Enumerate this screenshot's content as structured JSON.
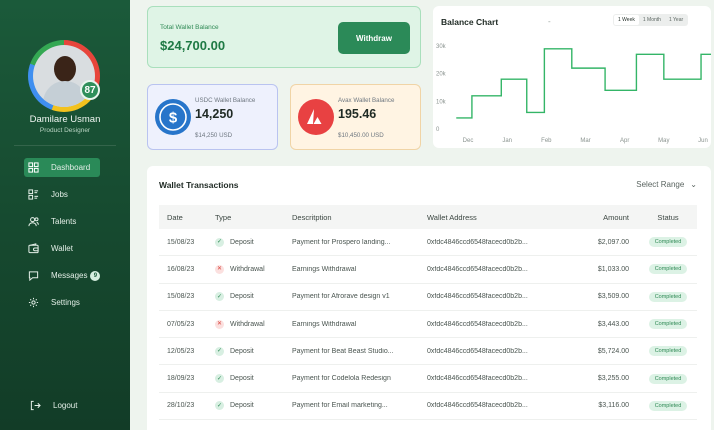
{
  "user": {
    "name": "Damilare Usman",
    "role": "Product Designer",
    "level": "87"
  },
  "nav": [
    {
      "label": "Dashboard",
      "icon": "dashboard-icon",
      "active": true
    },
    {
      "label": "Jobs",
      "icon": "jobs-icon",
      "active": false
    },
    {
      "label": "Talents",
      "icon": "talents-icon",
      "active": false
    },
    {
      "label": "Wallet",
      "icon": "wallet-icon",
      "active": false
    },
    {
      "label": "Messages",
      "icon": "messages-icon",
      "active": false,
      "badge": "9"
    },
    {
      "label": "Settings",
      "icon": "settings-icon",
      "active": false
    }
  ],
  "logout_label": "Logout",
  "total_balance": {
    "label": "Total Wallet Balance",
    "value": "$24,700.00",
    "button": "Withdraw"
  },
  "wallets": {
    "usdc": {
      "label": "USDC Wallet Balance",
      "amount": "14,250",
      "usd": "$14,250 USD"
    },
    "avax": {
      "label": "Avax Wallet Balance",
      "amount": "195.46",
      "usd": "$10,450.00 USD"
    }
  },
  "colors": {
    "brand_green": "#1b5a3a",
    "accent_green": "#2b8a58",
    "usdc_blue": "#2775ca",
    "avax_red": "#e84142"
  },
  "balance_chart": {
    "title": "Balance Chart",
    "selector_dot": "-",
    "ranges": [
      "1 Week",
      "1 Month",
      "1 Year"
    ],
    "active_range": "1 Week",
    "chart_data": {
      "type": "line",
      "step": true,
      "categories": [
        "Dec",
        "Jan",
        "Feb",
        "Mar",
        "Apr",
        "May",
        "Jun"
      ],
      "y_ticks": [
        "30k",
        "20k",
        "10k",
        "0"
      ],
      "ylim": [
        0,
        30000
      ],
      "points": [
        {
          "x": 0.0,
          "y": 4000
        },
        {
          "x": 0.4,
          "y": 4000
        },
        {
          "x": 0.4,
          "y": 12000
        },
        {
          "x": 1.15,
          "y": 12000
        },
        {
          "x": 1.15,
          "y": 18000
        },
        {
          "x": 1.8,
          "y": 18000
        },
        {
          "x": 1.8,
          "y": 6000
        },
        {
          "x": 2.25,
          "y": 6000
        },
        {
          "x": 2.25,
          "y": 29000
        },
        {
          "x": 2.95,
          "y": 29000
        },
        {
          "x": 2.95,
          "y": 22000
        },
        {
          "x": 3.8,
          "y": 22000
        },
        {
          "x": 3.8,
          "y": 14000
        },
        {
          "x": 4.6,
          "y": 14000
        },
        {
          "x": 4.6,
          "y": 27000
        },
        {
          "x": 5.3,
          "y": 27000
        },
        {
          "x": 5.3,
          "y": 18000
        },
        {
          "x": 6.25,
          "y": 18000
        },
        {
          "x": 6.25,
          "y": 27000
        },
        {
          "x": 7.3,
          "y": 27000
        }
      ],
      "grid": false,
      "legend": "none",
      "line_color": "#34b567"
    }
  },
  "transactions": {
    "title": "Wallet Transactions",
    "select_range": "Select Range",
    "columns": [
      "Date",
      "Type",
      "Descritption",
      "Wallet Address",
      "Amount",
      "Status"
    ],
    "rows": [
      {
        "date": "15/08/23",
        "type": "Deposit",
        "kind": "deposit",
        "desc": "Payment for Prospero landing...",
        "addr": "0xfdc4846ccd6548facecd0b2b...",
        "amount": "$2,097.00",
        "status": "Completed"
      },
      {
        "date": "16/08/23",
        "type": "Withdrawal",
        "kind": "withdrawal",
        "desc": "Earnings Withdrawal",
        "addr": "0xfdc4846ccd6548facecd0b2b...",
        "amount": "$1,033.00",
        "status": "Completed"
      },
      {
        "date": "15/08/23",
        "type": "Deposit",
        "kind": "deposit",
        "desc": "Payment for Afrorave design v1",
        "addr": "0xfdc4846ccd6548facecd0b2b...",
        "amount": "$3,509.00",
        "status": "Completed"
      },
      {
        "date": "07/05/23",
        "type": "Withdrawal",
        "kind": "withdrawal",
        "desc": "Earnings Withdrawal",
        "addr": "0xfdc4846ccd6548facecd0b2b...",
        "amount": "$3,443.00",
        "status": "Completed"
      },
      {
        "date": "12/05/23",
        "type": "Deposit",
        "kind": "deposit",
        "desc": "Payment for Beat Beast Studio...",
        "addr": "0xfdc4846ccd6548facecd0b2b...",
        "amount": "$5,724.00",
        "status": "Completed"
      },
      {
        "date": "18/09/23",
        "type": "Deposit",
        "kind": "deposit",
        "desc": "Payment for Codelola Redesign",
        "addr": "0xfdc4846ccd6548facecd0b2b...",
        "amount": "$3,255.00",
        "status": "Completed"
      },
      {
        "date": "28/10/23",
        "type": "Deposit",
        "kind": "deposit",
        "desc": "Payment for Email marketing...",
        "addr": "0xfdc4846ccd6548facecd0b2b...",
        "amount": "$3,116.00",
        "status": "Completed"
      }
    ]
  }
}
